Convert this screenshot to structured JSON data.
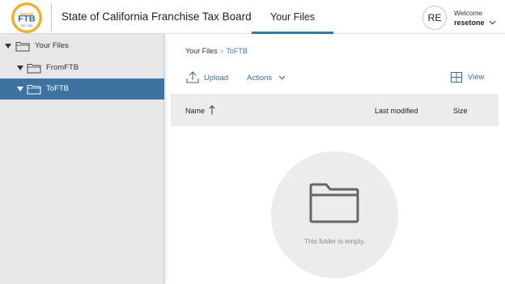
{
  "header": {
    "logo_text": "FTB",
    "logo_subtext": "EST. 1950",
    "app_title": "State of California Franchise Tax Board",
    "active_tab": "Your Files",
    "avatar_initials": "RE",
    "welcome": "Welcome",
    "username": "resetone",
    "logo_icon": "ftb-seal-logo",
    "menu_icon": "chevron-down-icon"
  },
  "sidebar": {
    "items": [
      {
        "label": "Your Files",
        "icon": "folder-icon",
        "expanded": true,
        "selected": false
      },
      {
        "label": "FromFTB",
        "icon": "folder-icon",
        "expanded": true,
        "selected": false
      },
      {
        "label": "ToFTB",
        "icon": "folder-icon",
        "expanded": true,
        "selected": true
      }
    ]
  },
  "breadcrumb": {
    "root": "Your Files",
    "separator": ">",
    "current": "ToFTB"
  },
  "toolbar": {
    "upload": "Upload",
    "actions": "Actions",
    "view": "View"
  },
  "table": {
    "columns": [
      "Name",
      "Last modified",
      "Size"
    ],
    "sort_column": "Name",
    "sort_direction": "ascending"
  },
  "empty_state": {
    "message": "This folder is empty.",
    "icon": "empty-folder-icon"
  },
  "colors": {
    "accent": "#3a78a4",
    "selected_row": "#3c73a1",
    "sidebar_bg": "#e7e7e7",
    "logo_gold": "#f0b132",
    "logo_blue": "#2f6f9f"
  }
}
